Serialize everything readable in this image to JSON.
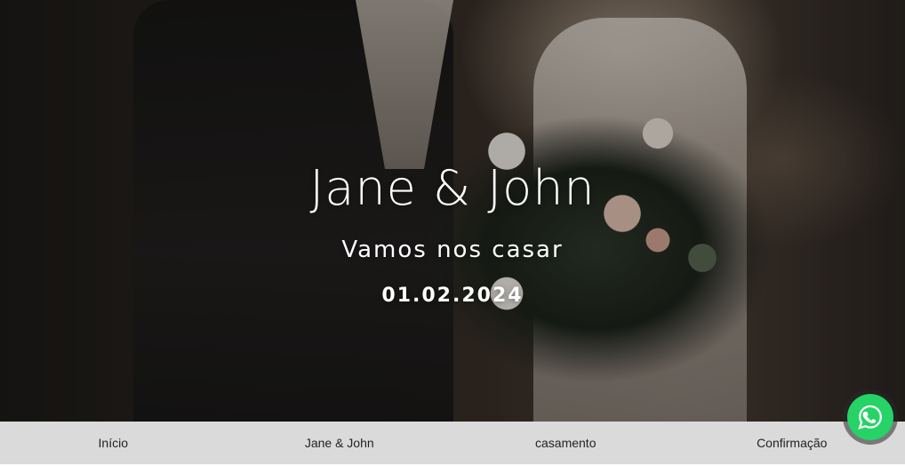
{
  "hero": {
    "title": "Jane & John",
    "subtitle": "Vamos nos casar",
    "date": "01.02.2024"
  },
  "nav": {
    "items": [
      {
        "label": "Início"
      },
      {
        "label": "Jane & John"
      },
      {
        "label": "casamento"
      },
      {
        "label": "Confirmação"
      }
    ]
  },
  "whatsapp": {
    "icon": "whatsapp-icon",
    "color": "#25d366"
  },
  "colors": {
    "nav_background": "#ebebeb",
    "hero_text": "#ffffff"
  }
}
